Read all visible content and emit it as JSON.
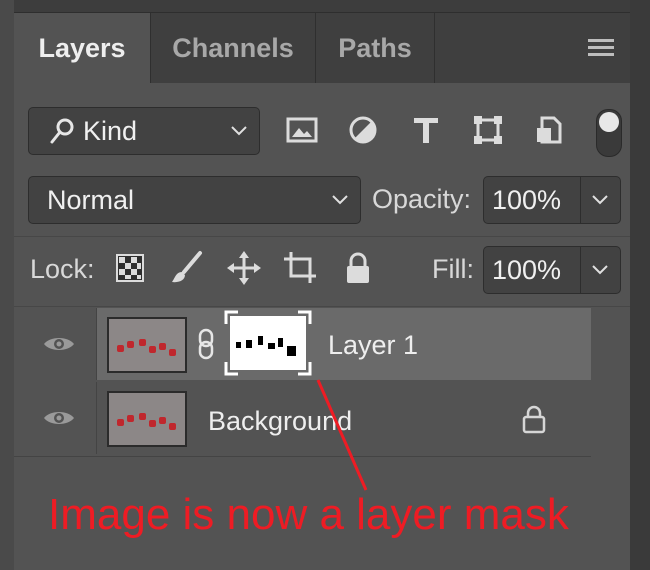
{
  "tabs": [
    {
      "label": "Layers",
      "active": true
    },
    {
      "label": "Channels",
      "active": false
    },
    {
      "label": "Paths",
      "active": false
    }
  ],
  "filter": {
    "kind_label": "Kind"
  },
  "blend": {
    "mode": "Normal",
    "opacity_label": "Opacity:",
    "opacity_value": "100%"
  },
  "lock": {
    "label": "Lock:",
    "fill_label": "Fill:",
    "fill_value": "100%"
  },
  "layers": [
    {
      "name": "Layer 1",
      "selected": true,
      "has_mask": true
    },
    {
      "name": "Background",
      "selected": false,
      "locked": true
    }
  ],
  "annotation": {
    "text": "Image is now a layer mask",
    "color": "#ee1c24"
  },
  "colors": {
    "panel": "#535353",
    "tabbar": "#3f3f3f",
    "selected_row": "#6a6a6a",
    "annotation": "#ee1c24"
  }
}
